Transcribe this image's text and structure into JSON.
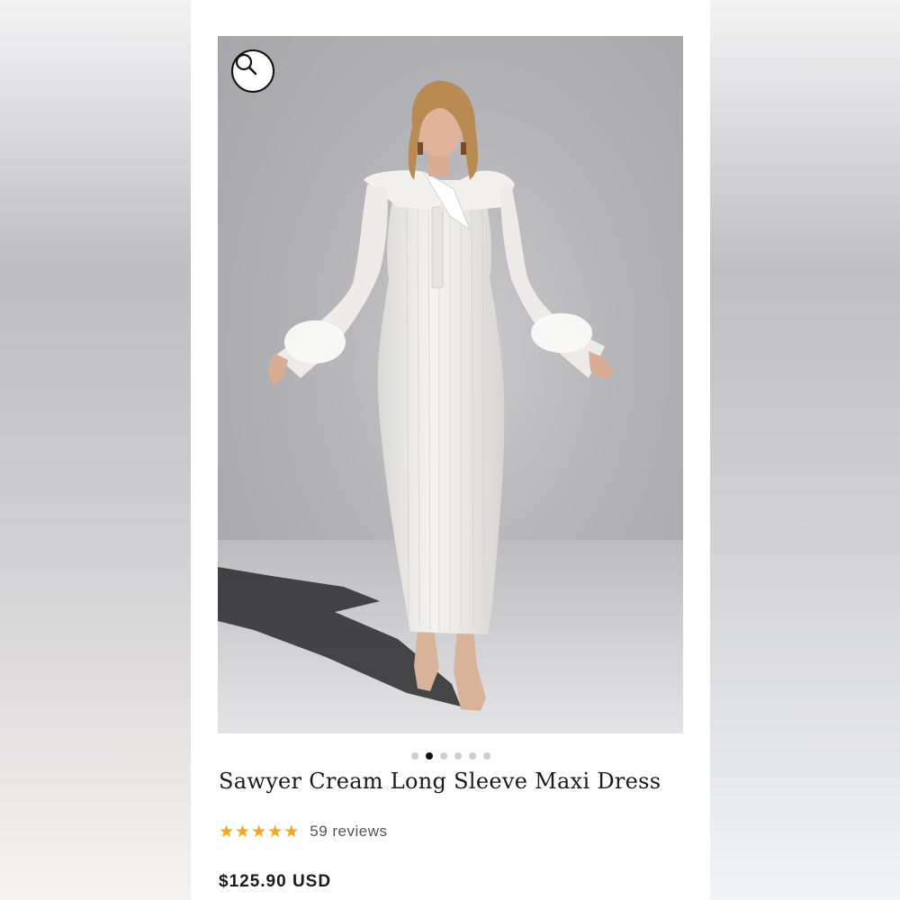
{
  "product": {
    "title": "Sawyer Cream Long Sleeve Maxi Dress",
    "rating": {
      "stars": 5,
      "reviews_label": "59 reviews"
    },
    "price": "$125.90 USD"
  },
  "gallery": {
    "image_count": 6,
    "active_index": 1,
    "image_description": "Model in cream ribbed long sleeve maxi dress with feather cuffs",
    "zoom_icon": "search-icon"
  },
  "colors": {
    "star": "#f5a623",
    "active_dot": "#111111",
    "inactive_dot": "#cfcfcf"
  }
}
